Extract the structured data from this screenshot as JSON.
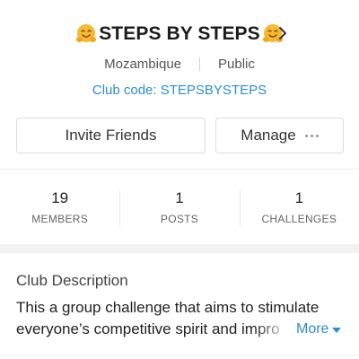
{
  "header": {
    "title": "STEPS BY STEPS",
    "emoji_icon": "hugging-face-icon",
    "chevron_icon": "chevron-right-icon"
  },
  "meta": {
    "location": "Mozambique",
    "visibility": "Public"
  },
  "club_code": "Club code: STEPSBYSTEPS",
  "actions": {
    "invite_label": "Invite Friends",
    "manage_label": "Manage"
  },
  "stats": [
    {
      "value": "19",
      "label": "MEMBERS"
    },
    {
      "value": "1",
      "label": "POSTS"
    },
    {
      "value": "1",
      "label": "CHALLENGES"
    }
  ],
  "description": {
    "title": "Club Description",
    "text": "This a group challenge that aims to stimulate everyone’s competitive spirit and impro",
    "more_label": "More"
  },
  "colors": {
    "accent": "#2a8fd6",
    "emoji": "#f7b932"
  }
}
